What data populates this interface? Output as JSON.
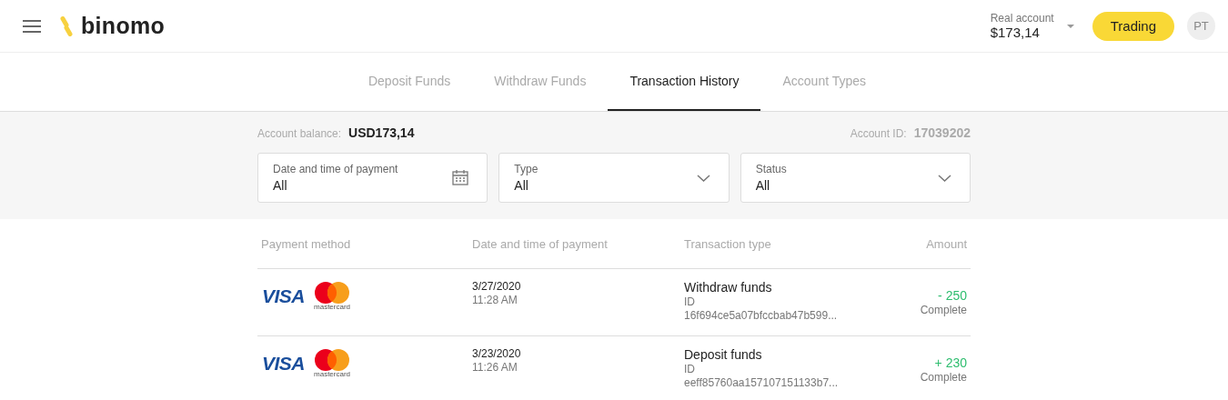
{
  "header": {
    "logo": "binomo",
    "account_label": "Real account",
    "account_balance": "$173,14",
    "trading_button": "Trading",
    "avatar": "PT"
  },
  "tabs": [
    {
      "label": "Deposit Funds",
      "selected": false
    },
    {
      "label": "Withdraw Funds",
      "selected": false
    },
    {
      "label": "Transaction History",
      "selected": true
    },
    {
      "label": "Account Types",
      "selected": false
    }
  ],
  "summary": {
    "balance_label": "Account balance:",
    "balance": "USD173,14",
    "account_id_label": "Account ID:",
    "account_id": "17039202"
  },
  "filters": [
    {
      "kind": "date",
      "label": "Date and time of payment",
      "value": "All"
    },
    {
      "kind": "select",
      "label": "Type",
      "value": "All"
    },
    {
      "kind": "select",
      "label": "Status",
      "value": "All"
    }
  ],
  "table": {
    "columns": [
      "Payment method",
      "Date and time of payment",
      "Transaction type",
      "Amount"
    ],
    "rows": [
      {
        "visa": "VISA",
        "mastercard": "mastercard",
        "date": "3/27/2020",
        "time": "11:28 AM",
        "type": "Withdraw funds",
        "id_label": "ID",
        "id": "16f694ce5a07bfccbab47b599...",
        "amount": "- 250",
        "status": "Complete"
      },
      {
        "visa": "VISA",
        "mastercard": "mastercard",
        "date": "3/23/2020",
        "time": "11:26 AM",
        "type": "Deposit funds",
        "id_label": "ID",
        "id": "eeff85760aa157107151133b7...",
        "amount": "+ 230",
        "status": "Complete"
      }
    ]
  }
}
